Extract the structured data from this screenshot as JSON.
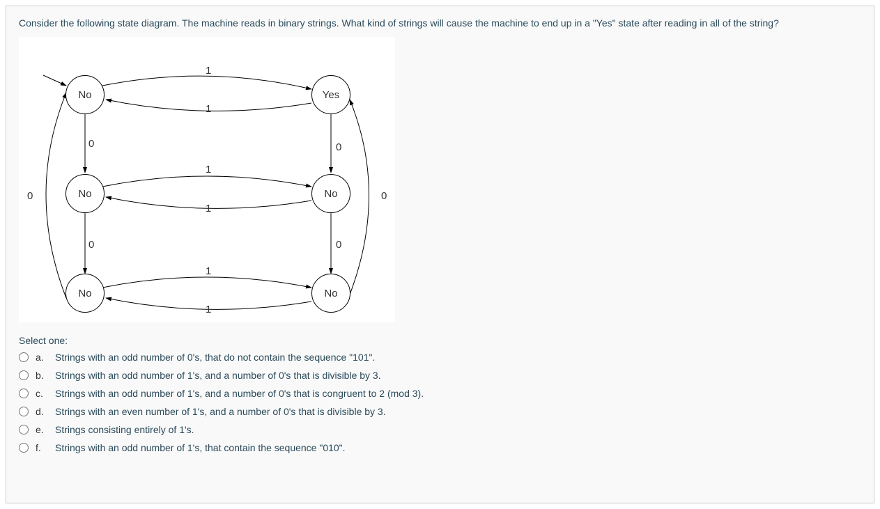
{
  "question": {
    "text": "Consider the following state diagram. The machine reads in binary strings. What kind of strings will cause the machine to end up in a \"Yes\" state after reading in all of the string?",
    "select_one": "Select one:"
  },
  "diagram": {
    "states": {
      "s0": "No",
      "s1": "Yes",
      "s2": "No",
      "s3": "No",
      "s4": "No",
      "s5": "No"
    },
    "labels": {
      "top_1_upper": "1",
      "top_1_lower": "1",
      "mid_1_upper": "1",
      "mid_1_lower": "1",
      "bot_1_upper": "1",
      "bot_1_lower": "1",
      "left_0_top": "0",
      "left_0_bottom": "0",
      "right_0_top": "0",
      "right_0_bottom": "0",
      "far_left_0": "0",
      "far_right_0": "0"
    }
  },
  "options": [
    {
      "letter": "a.",
      "text": "Strings with an odd number of 0's, that do not contain the sequence \"101\"."
    },
    {
      "letter": "b.",
      "text": "Strings with an odd number of 1's, and a number of 0's that is divisible by 3."
    },
    {
      "letter": "c.",
      "text": "Strings with an odd number of 1's, and a number of 0's that is congruent to 2 (mod 3)."
    },
    {
      "letter": "d.",
      "text": "Strings with an even number of 1's, and a number of 0's that is divisible by 3."
    },
    {
      "letter": "e.",
      "text": "Strings consisting entirely of 1's."
    },
    {
      "letter": "f.",
      "text": "Strings with an odd number of 1's, that contain the sequence \"010\"."
    }
  ]
}
